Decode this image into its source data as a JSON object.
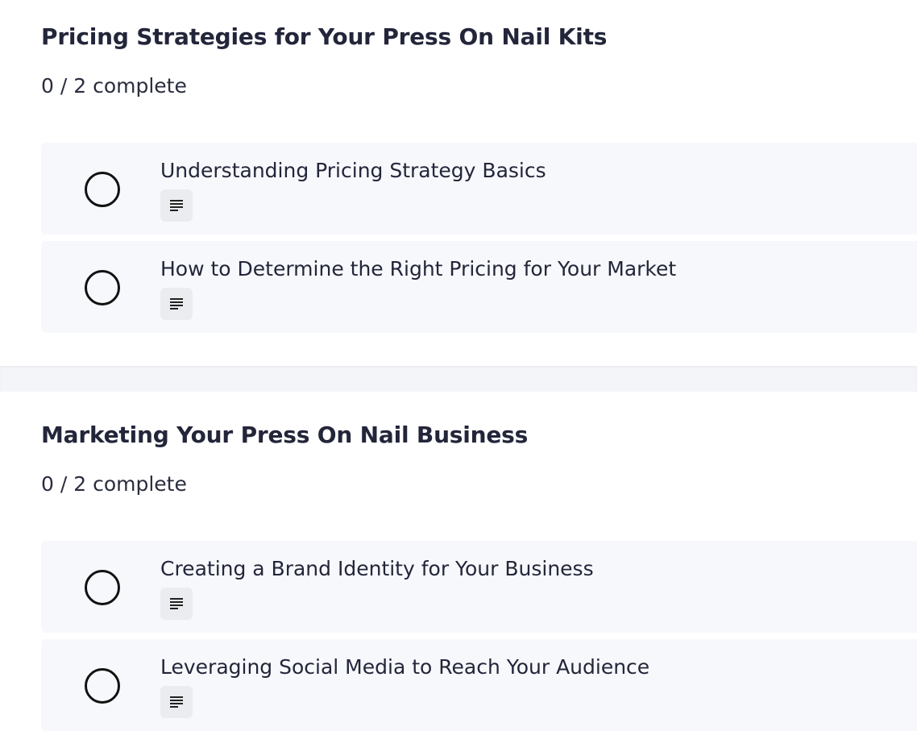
{
  "sections": [
    {
      "title": "Pricing Strategies for Your Press On Nail Kits",
      "progress": "0 / 2 complete",
      "lessons": [
        {
          "title": "Understanding Pricing Strategy Basics",
          "type_icon": "text-lines-icon",
          "completed": false
        },
        {
          "title": "How to Determine the Right Pricing for Your Market",
          "type_icon": "text-lines-icon",
          "completed": false
        }
      ]
    },
    {
      "title": "Marketing Your Press On Nail Business",
      "progress": "0 / 2 complete",
      "lessons": [
        {
          "title": "Creating a Brand Identity for Your Business",
          "type_icon": "text-lines-icon",
          "completed": false
        },
        {
          "title": "Leveraging Social Media to Reach Your Audience",
          "type_icon": "text-lines-icon",
          "completed": false
        }
      ]
    }
  ],
  "colors": {
    "heading": "#23263a",
    "lesson_bg": "#f7f8fb",
    "badge_bg": "#ebecf0",
    "divider_bg": "#f4f5f8",
    "checkbox_border": "#111111"
  }
}
